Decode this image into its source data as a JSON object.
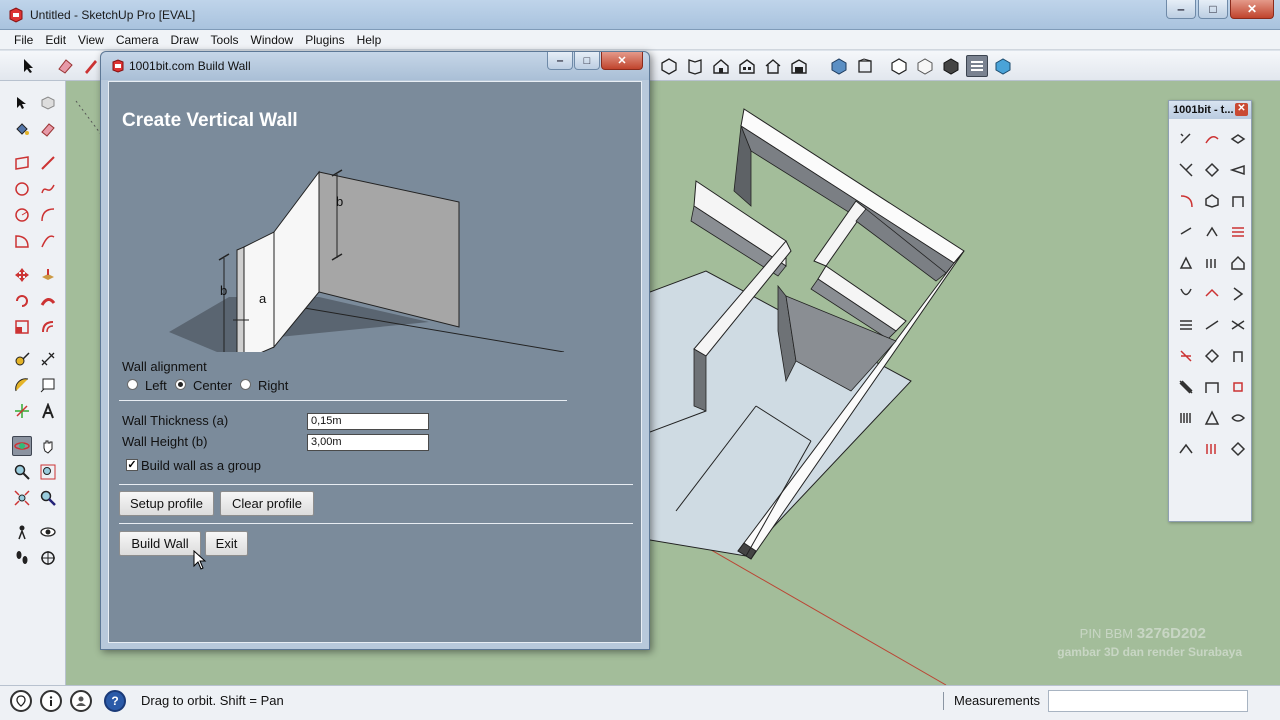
{
  "window": {
    "title": "Untitled - SketchUp Pro [EVAL]",
    "controls": [
      "‒",
      "□",
      "✕"
    ]
  },
  "menu": [
    "File",
    "Edit",
    "View",
    "Camera",
    "Draw",
    "Tools",
    "Window",
    "Plugins",
    "Help"
  ],
  "dialog": {
    "title": "1001bit.com Build Wall",
    "heading": "Create Vertical Wall",
    "illustration_labels": {
      "b_top": "b",
      "b_left": "b",
      "a": "a"
    },
    "alignment": {
      "label": "Wall alignment",
      "options": [
        "Left",
        "Center",
        "Right"
      ],
      "selected": "Center"
    },
    "thickness": {
      "label": "Wall Thickness (a)",
      "value": "0,15m"
    },
    "height": {
      "label": "Wall Height (b)",
      "value": "3,00m"
    },
    "group": {
      "label": "Build wall as a group",
      "checked": true
    },
    "buttons": {
      "setup_profile": "Setup profile",
      "clear_profile": "Clear profile",
      "build_wall": "Build Wall",
      "exit": "Exit"
    }
  },
  "palette": {
    "title": "1001bit - t...",
    "close": "✕"
  },
  "status": {
    "hint": "Drag to orbit.  Shift = Pan",
    "measurements_label": "Measurements",
    "measurements_value": ""
  },
  "watermark": {
    "line1_prefix": "PIN BBM",
    "line1_code": "3276D202",
    "line2": "gambar 3D dan render Surabaya"
  },
  "colors": {
    "viewport_green": "#a3bd9a",
    "dialog_body": "#7b8b9b",
    "accent_red": "#c0442d"
  }
}
